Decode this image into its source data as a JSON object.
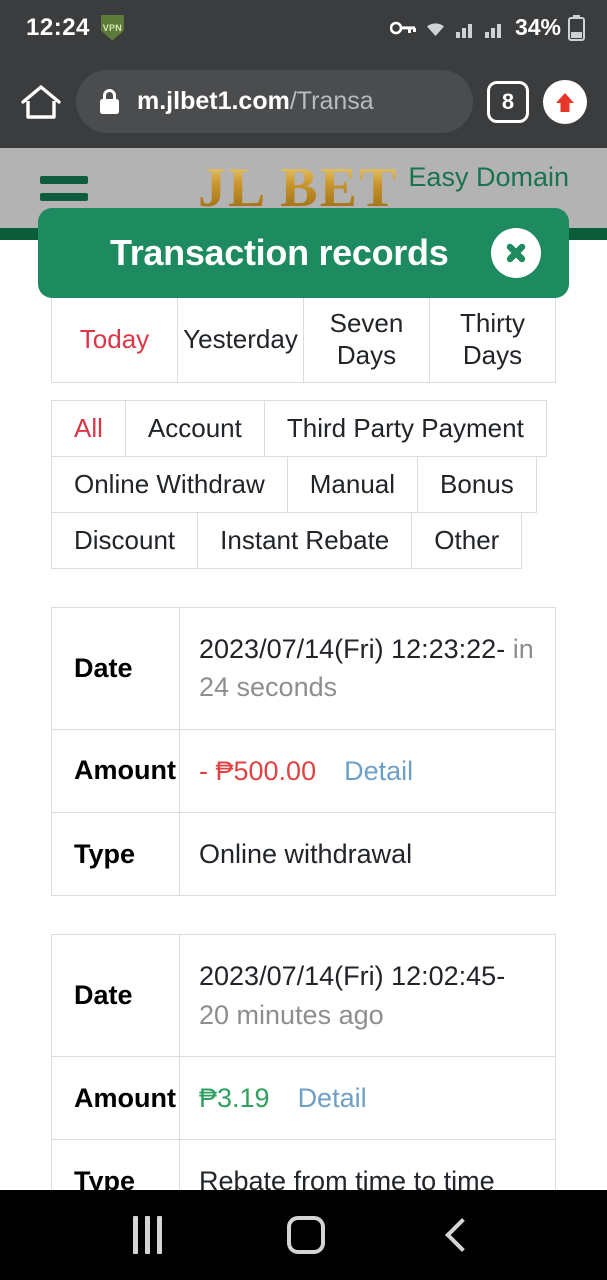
{
  "status_bar": {
    "time": "12:24",
    "vpn_badge": "VPN",
    "battery_percent": "34%",
    "icons": [
      "vpn-key-icon",
      "wifi-icon",
      "signal-icon",
      "signal-icon",
      "battery-icon"
    ]
  },
  "browser": {
    "lock_icon": "lock-icon",
    "url_domain": "m.jlbet1.com",
    "url_path": "/Transa",
    "tab_count": "8",
    "home_icon": "home-icon",
    "scroll_top_icon": "up-arrow-icon"
  },
  "site_header": {
    "menu_icon": "hamburger-menu-icon",
    "logo_text": "JL BET",
    "easy_domain": "Easy Domain"
  },
  "modal": {
    "title": "Transaction records",
    "close_icon": "close-icon"
  },
  "period_tabs": [
    {
      "label": "Today",
      "active": true
    },
    {
      "label": "Yesterday",
      "active": false
    },
    {
      "label": "Seven Days",
      "active": false
    },
    {
      "label": "Thirty Days",
      "active": false
    }
  ],
  "type_chips": [
    [
      {
        "label": "All",
        "active": true
      },
      {
        "label": "Account",
        "active": false
      },
      {
        "label": "Third Party Payment",
        "active": false
      }
    ],
    [
      {
        "label": "Online Withdraw",
        "active": false
      },
      {
        "label": "Manual",
        "active": false
      },
      {
        "label": "Bonus",
        "active": false
      }
    ],
    [
      {
        "label": "Discount",
        "active": false
      },
      {
        "label": "Instant Rebate",
        "active": false
      },
      {
        "label": "Other",
        "active": false
      }
    ]
  ],
  "labels": {
    "date": "Date",
    "amount": "Amount",
    "type": "Type",
    "detail": "Detail"
  },
  "records": [
    {
      "date": "2023/07/14(Fri) 12:23:22-",
      "relative": " in 24 seconds",
      "amount": "- ₱500.00",
      "amount_sign": "negative",
      "type": "Online withdrawal"
    },
    {
      "date": "2023/07/14(Fri) 12:02:45-",
      "relative": " 20 minutes ago",
      "amount": "₱3.19",
      "amount_sign": "positive",
      "type": "Rebate from time to time"
    }
  ],
  "nav_bar": {
    "recents_icon": "recents-icon",
    "home_icon": "home-square-icon",
    "back_icon": "back-chevron-icon"
  },
  "colors": {
    "brand_green": "#1e8a5f",
    "dark_green": "#0a5c3a",
    "active_red": "#dc3545",
    "amount_negative": "#e04343",
    "amount_positive": "#2fa060",
    "detail_link": "#6e9fc6"
  }
}
